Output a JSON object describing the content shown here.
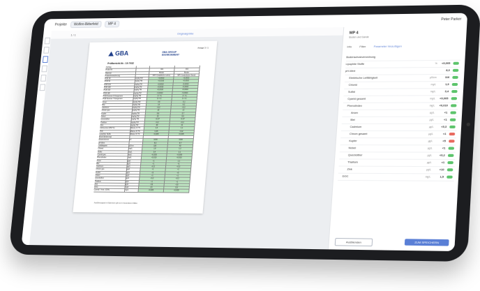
{
  "topbar": {
    "crumb1": "Projekte",
    "crumb2": "Wolfen-Bitterfeld",
    "crumb3": "MP 4",
    "user": "Peter Parker"
  },
  "toolbar": {
    "zoom": "1 / 1",
    "mode": "Originalgröße"
  },
  "doc": {
    "brand": "GBA",
    "group_line1": "GBA GROUP",
    "group_line2": "ENVIRONMENT",
    "anlage": "Anlage 3 / 1",
    "title": "Prüfbericht-Nr.:",
    "number": "19-7432",
    "rows": [
      [
        "Auftrag",
        "",
        "",
        ""
      ],
      [
        "Probe-Nr.",
        "",
        "001",
        "002"
      ],
      [
        "Material",
        "",
        "Boden",
        "Boden"
      ],
      [
        "Probenbezeichnung",
        "",
        "MP 4 (natürliche Lehm)",
        "MP 5 (natürlicher Sand)"
      ],
      [
        "PCB 28",
        "mg/kg TM",
        "<0,0010",
        "<0,0010"
      ],
      [
        "PCB 52",
        "mg/kg TM",
        "<0,0010",
        "<0,0010"
      ],
      [
        "PCB 101",
        "mg/kg TM",
        "<0,0010",
        "<0,0010"
      ],
      [
        "PCB 138",
        "mg/kg TM",
        "<0,0010",
        "<0,0010"
      ],
      [
        "PCB 153",
        "mg/kg TM",
        "<0,0010",
        "<0,0010"
      ],
      [
        "PCB 180",
        "mg/kg TM",
        "<0,0010",
        "<0,0010"
      ],
      [
        "PCB Summe 6 Kongenere",
        "mg/kg TM",
        "(n. b.)",
        "(n. b.)"
      ],
      [
        "PCB Summe 7 Kongenere",
        "mg/kg TM",
        "(n. b.)",
        "(n. b.)"
      ],
      [
        "Arsen",
        "mg/kg TM",
        "4,6",
        "5,1"
      ],
      [
        "Blei",
        "mg/kg TM",
        "14",
        "8,2"
      ],
      [
        "Cadmium",
        "mg/kg TM",
        "<0,2",
        "<0,2"
      ],
      [
        "Chrom ges.",
        "mg/kg TM",
        "18",
        "13"
      ],
      [
        "Kupfer",
        "mg/kg TM",
        "9,8",
        "5,7"
      ],
      [
        "Nickel",
        "mg/kg TM",
        "15",
        "9,6"
      ],
      [
        "Quecksilber",
        "mg/kg TM",
        "<0,07",
        "<0,07"
      ],
      [
        "Thallium",
        "mg/kg TM",
        "<0,2",
        "<0,2"
      ],
      [
        "Zink",
        "mg/kg TM",
        "38",
        "21"
      ],
      [
        "Glühverlust (550°C)",
        "Masse-% TS",
        "2,3",
        "1,1"
      ],
      [
        "TOC",
        "Masse-% TS",
        "0,35",
        "0,12"
      ],
      [
        "Lipophile Stoffe",
        "Masse-% TS",
        "<0,005",
        "<0,005"
      ],
      [
        "Eluat (Eluierung)",
        "",
        "",
        ""
      ],
      [
        "Eluatvolumen",
        "ml",
        "1000",
        "1000"
      ],
      [
        "pH-Wert",
        "",
        "8,3",
        "8,7"
      ],
      [
        "Leitfähigkeit",
        "µS/cm",
        "116",
        "62"
      ],
      [
        "Chlorid",
        "mg/L",
        "1,9",
        "1,2"
      ],
      [
        "Sulfat",
        "mg/L",
        "3,4",
        "2,1"
      ],
      [
        "Cyanid ges.",
        "mg/L",
        "<0,005",
        "<0,005"
      ],
      [
        "Phenolindex",
        "mg/L",
        "<0,010",
        "<0,010"
      ],
      [
        "Arsen",
        "µg/L",
        "<1",
        "1,1"
      ],
      [
        "Blei",
        "µg/L",
        "<1",
        "<1"
      ],
      [
        "Cadmium",
        "µg/L",
        "<0,3",
        "<0,3"
      ],
      [
        "Chrom ges.",
        "µg/L",
        "<1",
        "<1"
      ],
      [
        "Kupfer",
        "µg/L",
        "<5",
        "<5"
      ],
      [
        "Nickel",
        "µg/L",
        "<1",
        "<1"
      ],
      [
        "Quecksilber",
        "µg/L",
        "<0,2",
        "<0,2"
      ],
      [
        "Thallium",
        "µg/L",
        "<1",
        "<1"
      ],
      [
        "Zink",
        "µg/L",
        "<10",
        "<10"
      ],
      [
        "DOC",
        "mg/L",
        "1,5",
        "0,9"
      ],
      [
        "Cyanid l. freis. (CFA)",
        "mg/L",
        "<0,005",
        "<0,005"
      ]
    ],
    "footnote": "Ausführungsart in Klammern gilt nur in besonderen Fällen."
  },
  "panel": {
    "title": "MP 4",
    "subtitle": "Boden und Sande",
    "tabs": [
      "Info",
      "Filter",
      "Parameter hinzufügen"
    ],
    "items": [
      {
        "label": "Bodenschutzverordnung",
        "unit": "",
        "value": ""
      },
      {
        "label": "Lipophile Stoffe",
        "unit": "%",
        "value": "<0,005"
      },
      {
        "label": "pH-Wert",
        "unit": "",
        "value": "8,3"
      },
      {
        "label": "Elektrische Leitfähigkeit",
        "unit": "µS/cm",
        "value": "116"
      },
      {
        "label": "Chlorid",
        "unit": "mg/L",
        "value": "1,9"
      },
      {
        "label": "Sulfat",
        "unit": "mg/L",
        "value": "3,4"
      },
      {
        "label": "Cyanid gesamt",
        "unit": "mg/L",
        "value": "<0,005"
      },
      {
        "label": "Phenolindex",
        "unit": "mg/L",
        "value": "<0,010"
      },
      {
        "label": "Arsen",
        "unit": "µg/L",
        "value": "<1"
      },
      {
        "label": "Blei",
        "unit": "µg/L",
        "value": "<1"
      },
      {
        "label": "Cadmium",
        "unit": "µg/L",
        "value": "<0,3"
      },
      {
        "label": "Chrom gesamt",
        "unit": "µg/L",
        "value": "<1"
      },
      {
        "label": "Kupfer",
        "unit": "µg/L",
        "value": "<5"
      },
      {
        "label": "Nickel",
        "unit": "µg/L",
        "value": "<1"
      },
      {
        "label": "Quecksilber",
        "unit": "µg/L",
        "value": "<0,2"
      },
      {
        "label": "Thallium",
        "unit": "µg/L",
        "value": "<1"
      },
      {
        "label": "Zink",
        "unit": "µg/L",
        "value": "<10"
      },
      {
        "label": "DOC",
        "unit": "mg/L",
        "value": "1,5"
      }
    ],
    "btn_secondary": "Ausblenden",
    "btn_primary": "ZUM SPEICHERN"
  }
}
